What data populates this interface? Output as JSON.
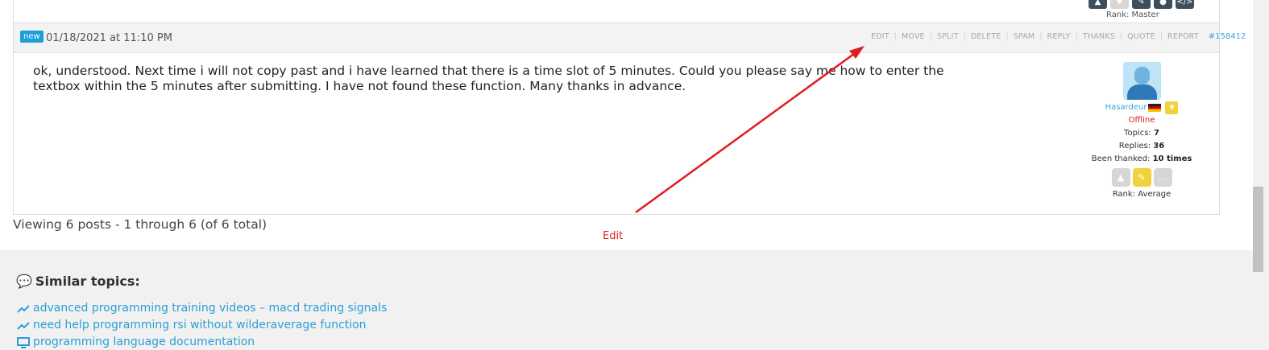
{
  "prev_post": {
    "rank_text": "Rank: Master"
  },
  "post": {
    "new_badge": "new",
    "date": "01/18/2021 at 11:10 PM",
    "actions": [
      "EDIT",
      "MOVE",
      "SPLIT",
      "DELETE",
      "SPAM",
      "REPLY",
      "THANKS",
      "QUOTE",
      "REPORT"
    ],
    "post_number": "#158412",
    "body": "ok, understood. Next time i will not copy past and i have learned that there is a time slot of 5 minutes. Could you please say me how to enter the textbox within the 5 minutes after submitting. I have not found these function. Many thanks in advance.",
    "author": {
      "name": "Hasardeur",
      "status": "Offline",
      "topics_label": "Topics:",
      "topics_value": "7",
      "replies_label": "Replies:",
      "replies_value": "36",
      "thanked_label": "Been thanked:",
      "thanked_value": "10 times",
      "rank_text": "Rank: Average"
    }
  },
  "viewing_text": "Viewing 6 posts - 1 through 6 (of 6 total)",
  "annotation": {
    "label": "Edit",
    "color": "#e02020"
  },
  "similar": {
    "title": "Similar topics:",
    "items": [
      {
        "icon": "trend-up-icon",
        "label": "advanced programming training videos – macd trading signals"
      },
      {
        "icon": "trend-up-icon",
        "label": "need help programming rsi without wilderaverage function"
      },
      {
        "icon": "monitor-icon",
        "label": "programming language documentation"
      }
    ]
  },
  "colors": {
    "link": "#2a9fd6",
    "new_badge": "#1c9fd9",
    "offline": "#d62020",
    "rank_active": "#f2d23a"
  }
}
